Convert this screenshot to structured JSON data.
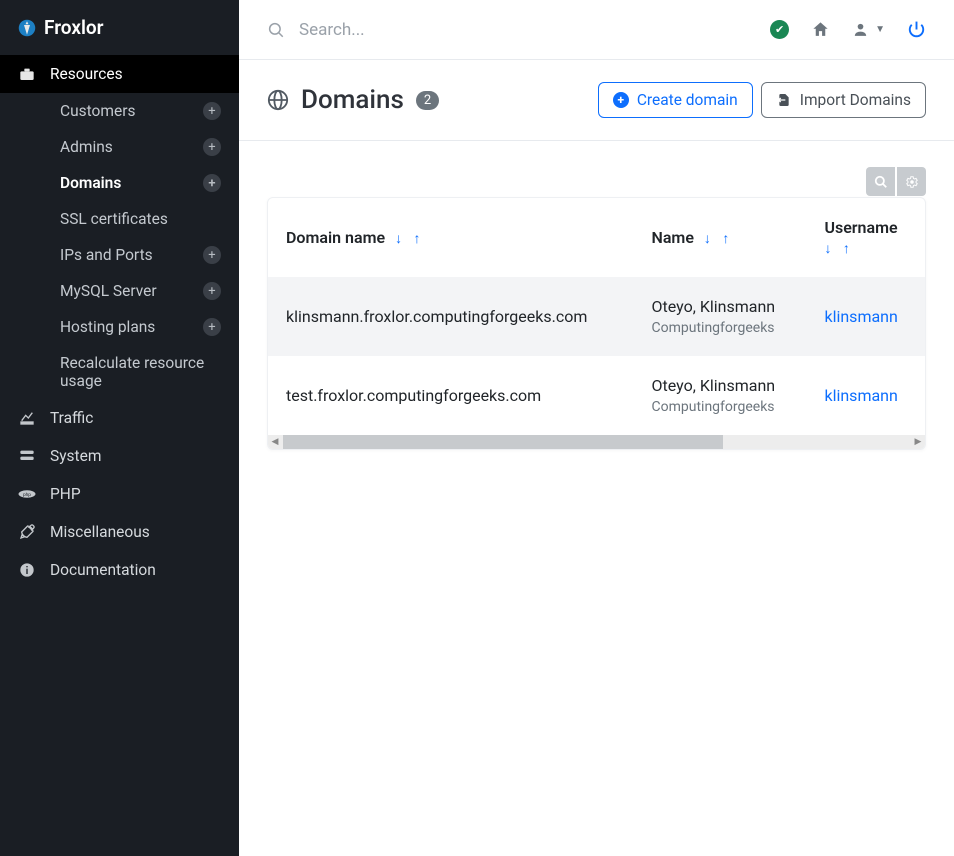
{
  "brand": "Froxlor",
  "search_placeholder": "Search...",
  "page": {
    "title": "Domains",
    "count": "2"
  },
  "buttons": {
    "create": "Create domain",
    "import": "Import Domains"
  },
  "sidebar": {
    "sections": [
      {
        "label": "Resources",
        "active": true,
        "items": [
          {
            "label": "Customers",
            "plus": true
          },
          {
            "label": "Admins",
            "plus": true
          },
          {
            "label": "Domains",
            "plus": true,
            "active": true
          },
          {
            "label": "SSL certificates"
          },
          {
            "label": "IPs and Ports",
            "plus": true
          },
          {
            "label": "MySQL Server",
            "plus": true
          },
          {
            "label": "Hosting plans",
            "plus": true
          },
          {
            "label": "Recalculate resource usage"
          }
        ]
      },
      {
        "label": "Traffic"
      },
      {
        "label": "System"
      },
      {
        "label": "PHP"
      },
      {
        "label": "Miscellaneous"
      },
      {
        "label": "Documentation"
      }
    ]
  },
  "table": {
    "headers": {
      "domain": "Domain name",
      "name": "Name",
      "username": "Username"
    },
    "rows": [
      {
        "domain": "klinsmann.froxlor.computingforgeeks.com",
        "name": "Oteyo, Klinsmann",
        "org": "Computingforgeeks",
        "username": "klinsmann"
      },
      {
        "domain": "test.froxlor.computingforgeeks.com",
        "name": "Oteyo, Klinsmann",
        "org": "Computingforgeeks",
        "username": "klinsmann"
      }
    ]
  }
}
